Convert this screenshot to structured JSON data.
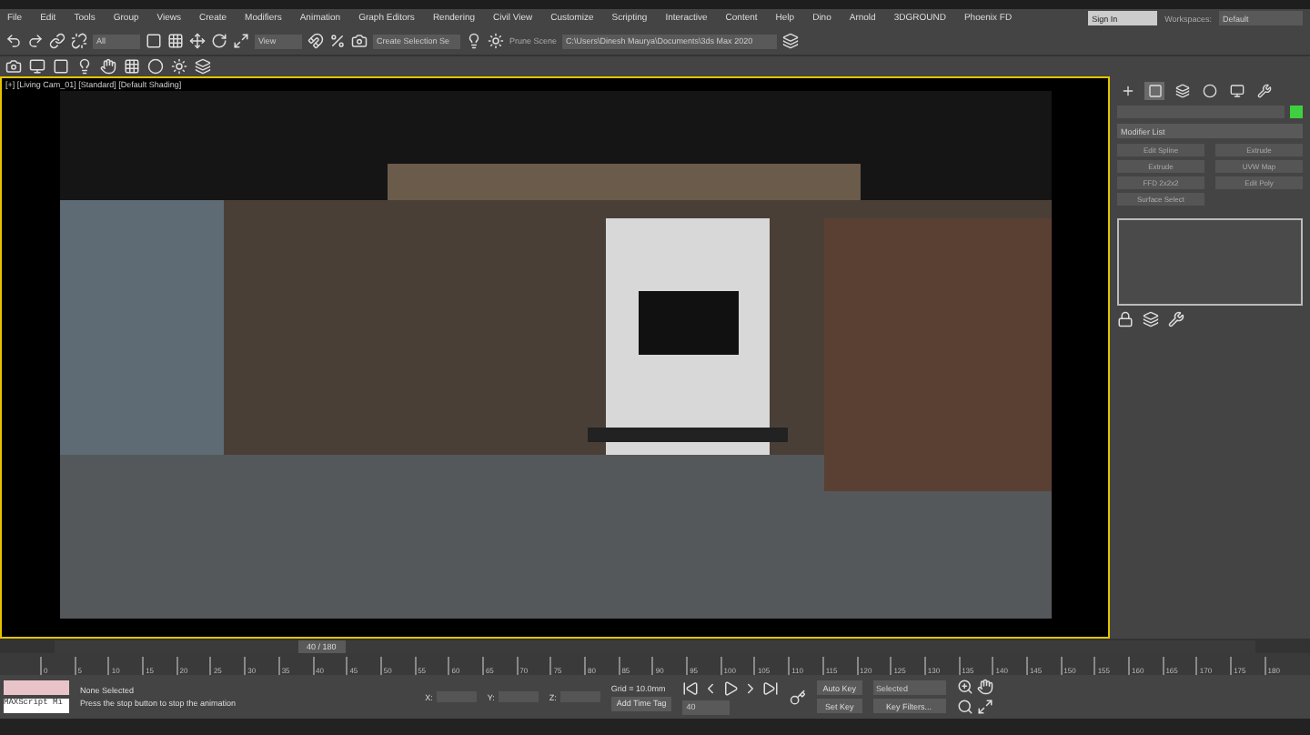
{
  "menu": [
    "File",
    "Edit",
    "Tools",
    "Group",
    "Views",
    "Create",
    "Modifiers",
    "Animation",
    "Graph Editors",
    "Rendering",
    "Civil View",
    "Customize",
    "Scripting",
    "Interactive",
    "Content",
    "Help",
    "Dino",
    "Arnold",
    "3DGROUND",
    "Phoenix FD"
  ],
  "account": {
    "sign_in": "Sign In",
    "workspaces_label": "Workspaces:",
    "workspace": "Default"
  },
  "toolbar": {
    "selection_filter": "All",
    "reference_coord": "View",
    "selection_set": "Create Selection Se",
    "scene_label": "Prune Scene",
    "project_path": "C:\\Users\\Dinesh Maurya\\Documents\\3ds Max 2020"
  },
  "viewport": {
    "label": "[+] [Living Cam_01] [Standard] [Default Shading]",
    "active": true
  },
  "command_panel": {
    "tabs": [
      {
        "selected": false
      },
      {
        "selected": true
      },
      {
        "selected": false
      },
      {
        "selected": false
      },
      {
        "selected": false
      },
      {
        "selected": false
      }
    ],
    "modifier_list": "Modifier List",
    "modifier_buttons": [
      "Edit Spline",
      "Extrude",
      "Extrude",
      "UVW Map",
      "FFD 2x2x2",
      "Edit Poly",
      "Surface Select"
    ]
  },
  "time_slider": {
    "label": "40 / 180",
    "level": 0.2222
  },
  "ruler_ticks": [
    "0",
    "5",
    "10",
    "15",
    "20",
    "25",
    "30",
    "35",
    "40",
    "45",
    "50",
    "55",
    "60",
    "65",
    "70",
    "75",
    "80",
    "85",
    "90",
    "95",
    "100",
    "105",
    "110",
    "115",
    "120",
    "125",
    "130",
    "135",
    "140",
    "145",
    "150",
    "155",
    "160",
    "165",
    "170",
    "175",
    "180"
  ],
  "status": {
    "maxscript": "MAXScript Mi",
    "selection": "None Selected",
    "prompt": "Press the stop button to stop the animation",
    "x_label": "X:",
    "y_label": "Y:",
    "z_label": "Z:",
    "grid": "Grid = 10.0mm",
    "time_tag": "Add Time Tag"
  },
  "animation": {
    "current_frame": "40",
    "auto_key": "Auto Key",
    "key_mode": "Selected",
    "set_key": "Set Key",
    "key_filters": "Key Filters..."
  }
}
